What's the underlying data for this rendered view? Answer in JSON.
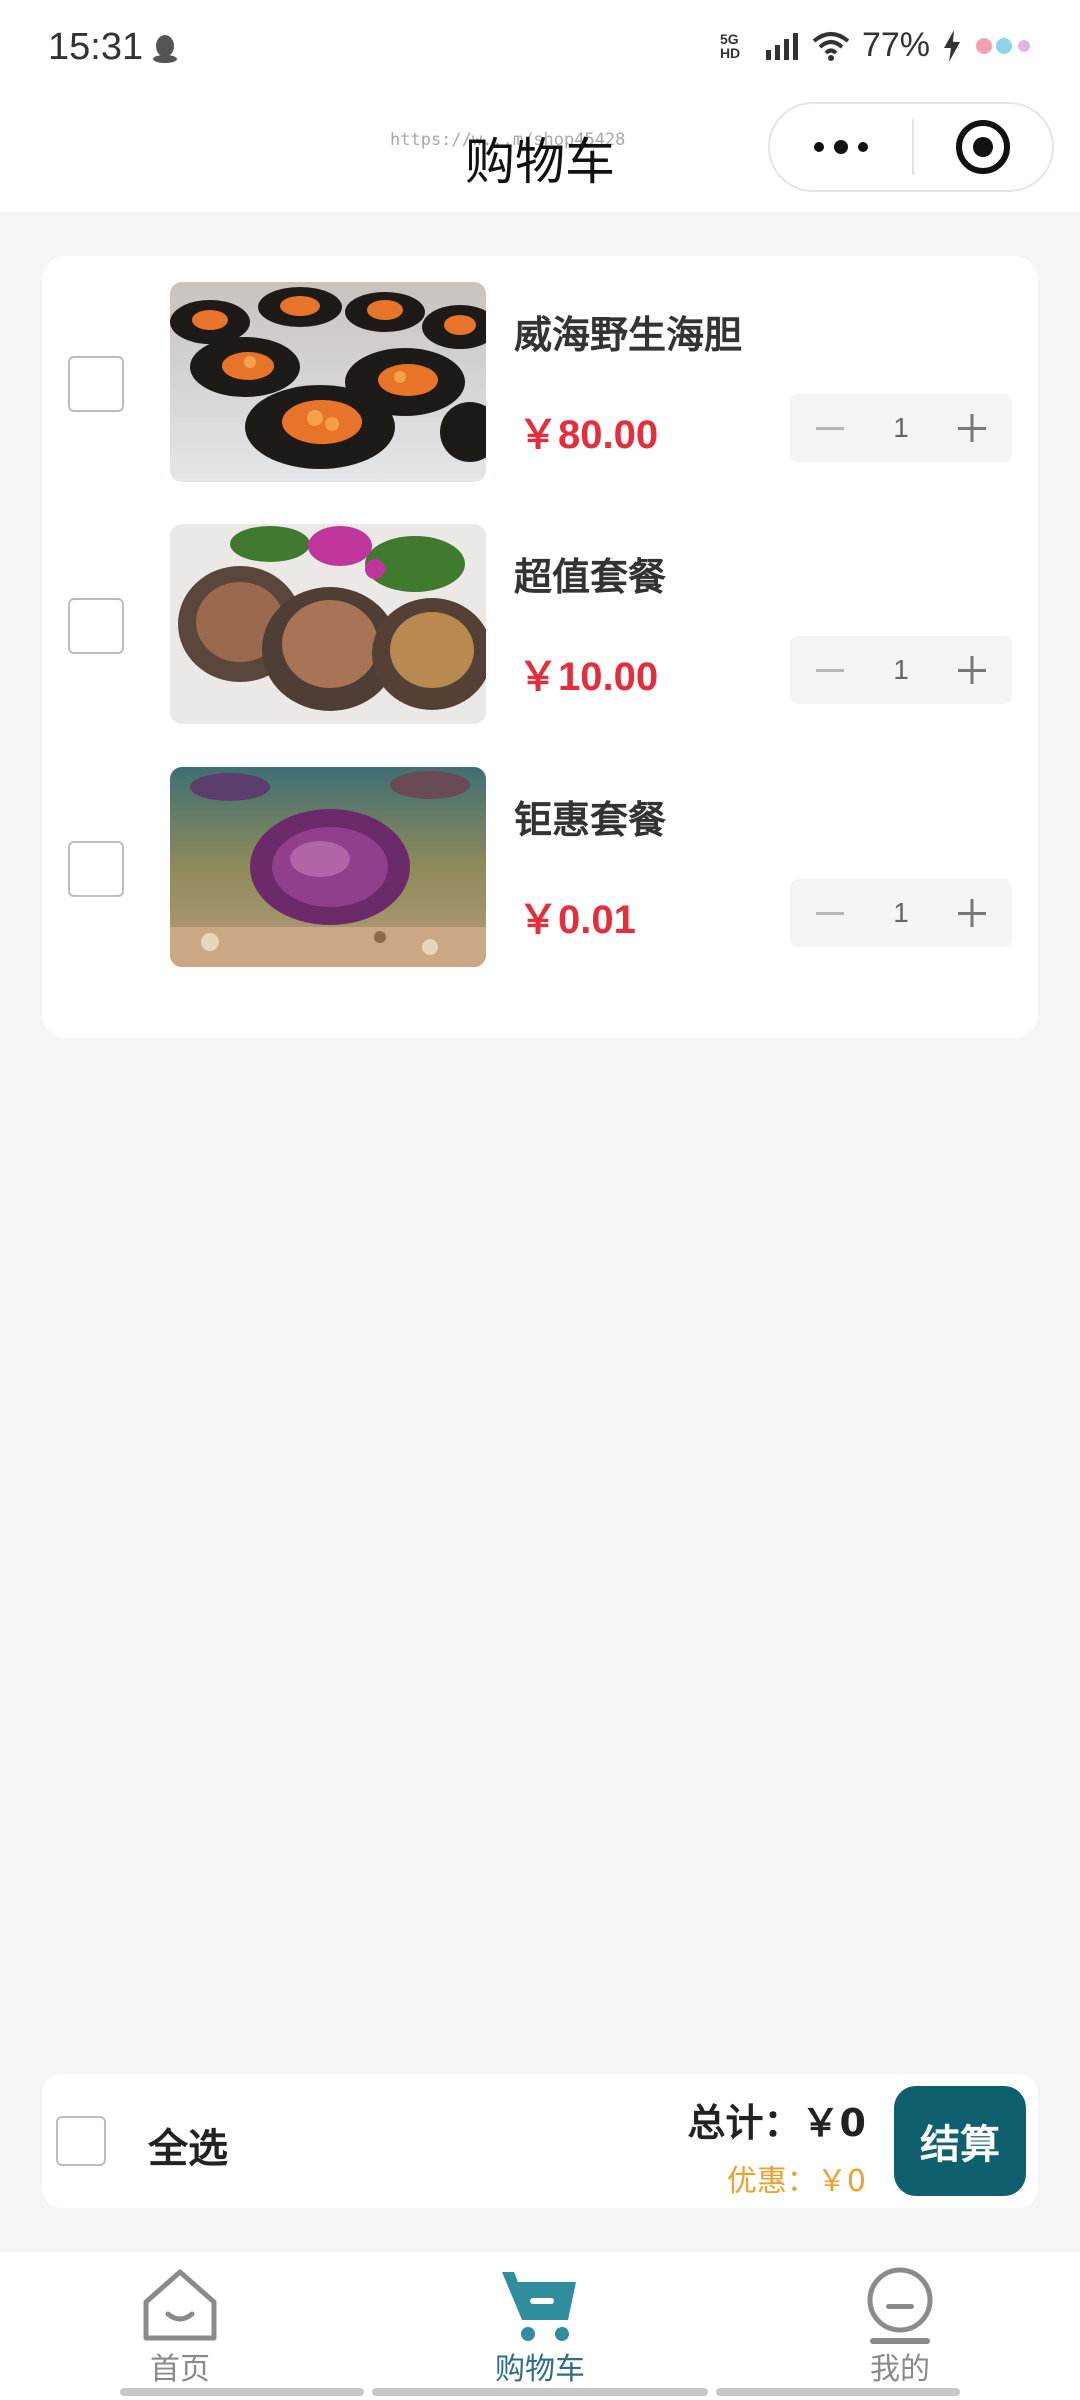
{
  "status_bar": {
    "time": "15:31",
    "network_label": "5G HD",
    "battery": "77%"
  },
  "nav": {
    "title": "购物车",
    "watermark": "https://w...m/shop45428"
  },
  "cart": {
    "items": [
      {
        "name": "威海野生海胆",
        "price": "￥80.00",
        "quantity": "1",
        "image": "sea-urchin-roe-image"
      },
      {
        "name": "超值套餐",
        "price": "￥10.00",
        "quantity": "1",
        "image": "abalone-platter-image"
      },
      {
        "name": "钜惠套餐",
        "price": "￥0.01",
        "quantity": "1",
        "image": "purple-sea-urchin-image"
      }
    ]
  },
  "footer": {
    "select_all_label": "全选",
    "total_label": "总计：",
    "total_value": "￥0",
    "discount_label": "优惠：",
    "discount_value": "￥0",
    "checkout_label": "结算"
  },
  "tabs": [
    {
      "label": "首页",
      "icon": "home-icon",
      "active": false
    },
    {
      "label": "购物车",
      "icon": "cart-icon",
      "active": true
    },
    {
      "label": "我的",
      "icon": "profile-icon",
      "active": false
    }
  ],
  "colors": {
    "price": "#e62d3c",
    "accent": "#0f5f6e",
    "discount": "#f0a030",
    "tab_active": "#2f6f7f"
  }
}
